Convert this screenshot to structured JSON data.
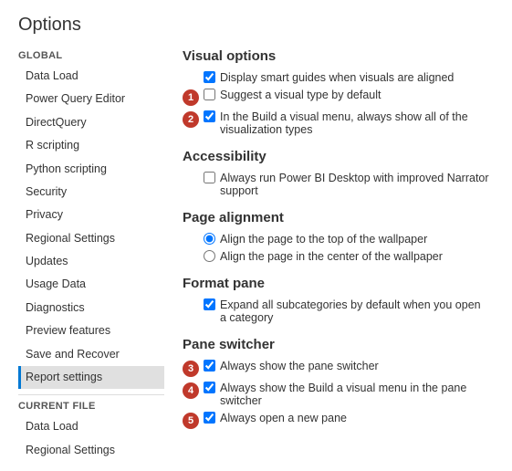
{
  "page": {
    "title": "Options"
  },
  "sidebar": {
    "global_label": "GLOBAL",
    "global_items": [
      {
        "label": "Data Load",
        "active": false
      },
      {
        "label": "Power Query Editor",
        "active": false
      },
      {
        "label": "DirectQuery",
        "active": false
      },
      {
        "label": "R scripting",
        "active": false
      },
      {
        "label": "Python scripting",
        "active": false
      },
      {
        "label": "Security",
        "active": false
      },
      {
        "label": "Privacy",
        "active": false
      },
      {
        "label": "Regional Settings",
        "active": false
      },
      {
        "label": "Updates",
        "active": false
      },
      {
        "label": "Usage Data",
        "active": false
      },
      {
        "label": "Diagnostics",
        "active": false
      },
      {
        "label": "Preview features",
        "active": false
      },
      {
        "label": "Save and Recover",
        "active": false
      },
      {
        "label": "Report settings",
        "active": true
      }
    ],
    "current_file_label": "CURRENT FILE",
    "current_file_items": [
      {
        "label": "Data Load",
        "active": false
      },
      {
        "label": "Regional Settings",
        "active": false
      }
    ]
  },
  "content": {
    "visual_options": {
      "title": "Visual options",
      "options": [
        {
          "id": "vo1",
          "text": "Display smart guides when visuals are aligned",
          "checked": true,
          "badge": null,
          "type": "checkbox"
        },
        {
          "id": "vo2",
          "text": "Suggest a visual type by default",
          "checked": false,
          "badge": "1",
          "type": "checkbox"
        },
        {
          "id": "vo3",
          "text": "In the Build a visual menu, always show all of the visualization types",
          "checked": true,
          "badge": "2",
          "type": "checkbox"
        }
      ]
    },
    "accessibility": {
      "title": "Accessibility",
      "options": [
        {
          "id": "ac1",
          "text": "Always run Power BI Desktop with improved Narrator support",
          "checked": false,
          "badge": null,
          "type": "checkbox"
        }
      ]
    },
    "page_alignment": {
      "title": "Page alignment",
      "options": [
        {
          "id": "pa1",
          "text": "Align the page to the top of the wallpaper",
          "checked": true,
          "badge": null,
          "type": "radio",
          "name": "page-align"
        },
        {
          "id": "pa2",
          "text": "Align the page in the center of the wallpaper",
          "checked": false,
          "badge": null,
          "type": "radio",
          "name": "page-align"
        }
      ]
    },
    "format_pane": {
      "title": "Format pane",
      "options": [
        {
          "id": "fp1",
          "text": "Expand all subcategories by default when you open a category",
          "checked": true,
          "badge": null,
          "type": "checkbox"
        }
      ]
    },
    "pane_switcher": {
      "title": "Pane switcher",
      "options": [
        {
          "id": "ps1",
          "text": "Always show the pane switcher",
          "checked": true,
          "badge": "3",
          "type": "checkbox"
        },
        {
          "id": "ps2",
          "text": "Always show the Build a visual menu in the pane switcher",
          "checked": true,
          "badge": "4",
          "type": "checkbox"
        },
        {
          "id": "ps3",
          "text": "Always open a new pane",
          "checked": true,
          "badge": "5",
          "type": "checkbox"
        }
      ]
    }
  }
}
